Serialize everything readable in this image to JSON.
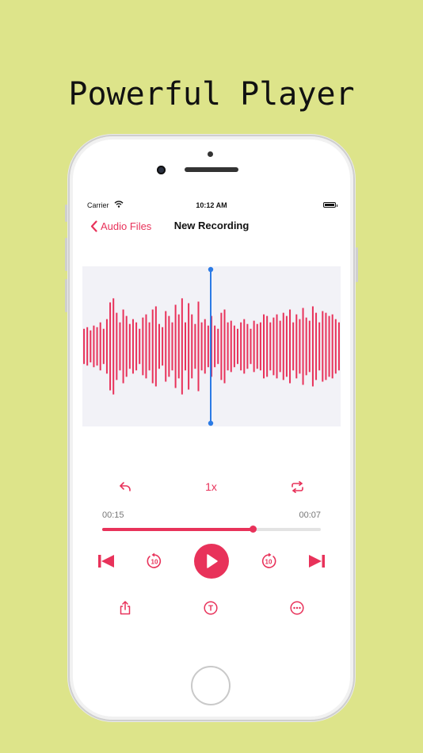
{
  "headline": "Powerful Player",
  "status_bar": {
    "carrier": "Carrier",
    "time": "10:12 AM"
  },
  "nav": {
    "back_label": "Audio Files",
    "title": "New Recording"
  },
  "player": {
    "speed_label": "1x",
    "elapsed": "00:15",
    "remaining": "00:07",
    "progress": 0.69,
    "skip_back_seconds": "10",
    "skip_forward_seconds": "10",
    "transcribe_glyph": "T"
  },
  "colors": {
    "accent": "#e8325a",
    "background": "#dde48a",
    "playhead": "#2c7be5",
    "wave_bg": "#f2f2f7"
  },
  "waveform_amplitudes": [
    0.22,
    0.24,
    0.2,
    0.26,
    0.24,
    0.3,
    0.22,
    0.34,
    0.55,
    0.6,
    0.42,
    0.3,
    0.46,
    0.38,
    0.28,
    0.34,
    0.3,
    0.22,
    0.36,
    0.4,
    0.3,
    0.46,
    0.5,
    0.28,
    0.24,
    0.44,
    0.38,
    0.3,
    0.52,
    0.4,
    0.6,
    0.3,
    0.54,
    0.4,
    0.28,
    0.56,
    0.3,
    0.34,
    0.26,
    0.38,
    0.26,
    0.22,
    0.42,
    0.46,
    0.3,
    0.32,
    0.26,
    0.22,
    0.3,
    0.34,
    0.28,
    0.22,
    0.32,
    0.28,
    0.3,
    0.4,
    0.38,
    0.3,
    0.36,
    0.4,
    0.32,
    0.42,
    0.38,
    0.46,
    0.3,
    0.4,
    0.34,
    0.48,
    0.36,
    0.32,
    0.5,
    0.42,
    0.3,
    0.44,
    0.42,
    0.38,
    0.4,
    0.34,
    0.3
  ]
}
